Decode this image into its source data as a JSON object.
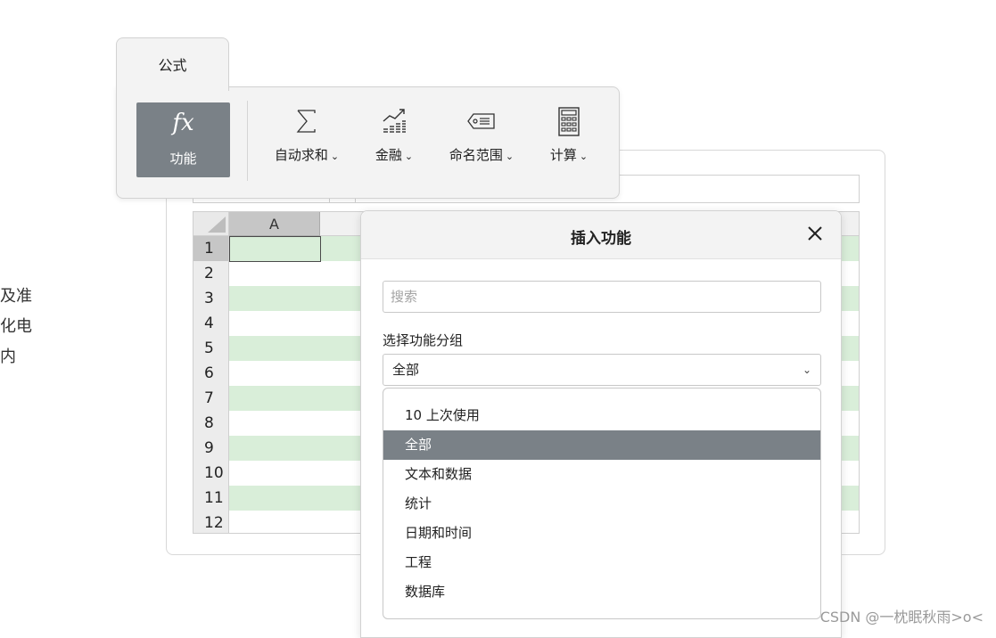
{
  "left_text": [
    "及准",
    "化电",
    "内"
  ],
  "ribbon": {
    "tab_label": "公式",
    "function_button": {
      "symbol": "fx",
      "label": "功能"
    },
    "tools": [
      {
        "label": "自动求和",
        "icon": "sigma-icon"
      },
      {
        "label": "金融",
        "icon": "finance-chart-icon"
      },
      {
        "label": "命名范围",
        "icon": "name-tag-icon"
      },
      {
        "label": "计算",
        "icon": "calculator-icon"
      }
    ]
  },
  "spreadsheet": {
    "column_header": "A",
    "rows": [
      "1",
      "2",
      "3",
      "4",
      "5",
      "6",
      "7",
      "8",
      "9",
      "10",
      "11",
      "12"
    ],
    "band_color": "#d9eed9"
  },
  "dialog": {
    "title": "插入功能",
    "search_placeholder": "搜索",
    "group_label": "选择功能分组",
    "group_selected": "全部",
    "options": [
      "10 上次使用",
      "全部",
      "文本和数据",
      "统计",
      "日期和时间",
      "工程",
      "数据库"
    ],
    "active_option": "全部"
  },
  "colors": {
    "accent_gray": "#7a8187",
    "panel_bg": "#f3f3f3"
  },
  "watermark": "CSDN @一枕眠秋雨>o<"
}
